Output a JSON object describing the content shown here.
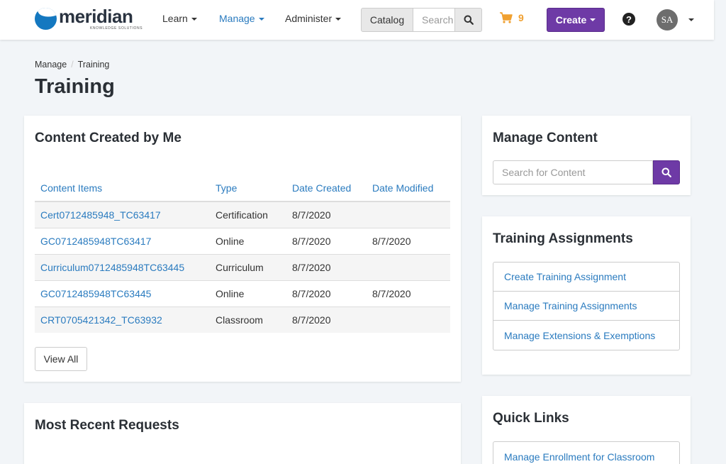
{
  "navbar": {
    "logo_text": "meridian",
    "logo_subtext": "KNOWLEDGE SOLUTIONS",
    "links": [
      {
        "label": "Learn"
      },
      {
        "label": "Manage"
      },
      {
        "label": "Administer"
      }
    ],
    "catalog_label": "Catalog",
    "catalog_search_placeholder": "Search",
    "cart_count": "9",
    "create_label": "Create",
    "help_label": "?",
    "avatar_initials": "SA",
    "colors": {
      "active_link": "#2a7bbf",
      "create": "#6e3aa6",
      "cart": "#f0a030"
    }
  },
  "breadcrumb": {
    "items": [
      "Manage",
      "Training"
    ],
    "separator": "/"
  },
  "page_title": "Training",
  "content_created": {
    "title": "Content Created by Me",
    "columns": [
      "Content Items",
      "Type",
      "Date Created",
      "Date Modified"
    ],
    "rows": [
      {
        "item": "Cert0712485948_TC63417",
        "type": "Certification",
        "created": "8/7/2020",
        "modified": ""
      },
      {
        "item": "GC0712485948TC63417",
        "type": "Online",
        "created": "8/7/2020",
        "modified": "8/7/2020"
      },
      {
        "item": "Curriculum0712485948TC63445",
        "type": "Curriculum",
        "created": "8/7/2020",
        "modified": ""
      },
      {
        "item": "GC0712485948TC63445",
        "type": "Online",
        "created": "8/7/2020",
        "modified": "8/7/2020"
      },
      {
        "item": "CRT0705421342_TC63932",
        "type": "Classroom",
        "created": "8/7/2020",
        "modified": ""
      }
    ],
    "view_all_label": "View All"
  },
  "recent_requests": {
    "title": "Most Recent Requests"
  },
  "manage_content": {
    "title": "Manage Content",
    "search_placeholder": "Search for Content"
  },
  "training_assignments": {
    "title": "Training Assignments",
    "items": [
      {
        "label": "Create Training Assignment"
      },
      {
        "label": "Manage Training Assignments"
      },
      {
        "label": "Manage Extensions & Exemptions"
      }
    ]
  },
  "quick_links": {
    "title": "Quick Links",
    "items": [
      {
        "label": "Manage Enrollment for Classroom"
      }
    ]
  },
  "icons": {
    "search": "search-icon",
    "cart": "shopping-cart-icon",
    "help": "question-circle-icon",
    "caret": "caret-down-icon"
  }
}
